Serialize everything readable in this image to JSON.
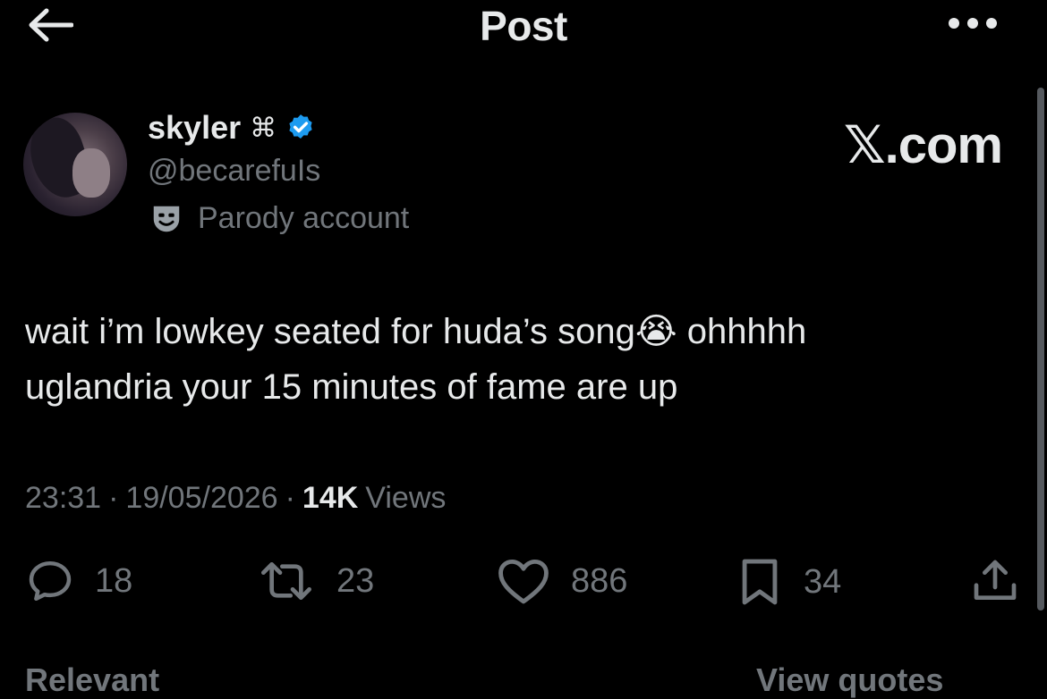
{
  "header": {
    "title": "Post",
    "back_icon": "arrow-left-icon",
    "more_icon": "more-horizontal-icon"
  },
  "author": {
    "name": "skyler",
    "name_symbol": "⌘",
    "handle": "@becarefuIs",
    "badge": "Parody account",
    "verified_color": "#1d9bf0"
  },
  "watermark": "𝕏.com",
  "tweet": {
    "line1_pre": "wait i’m lowkey seated for huda’s song",
    "emoji": "😭",
    "line1_post": " ohhhhh",
    "line2": "uglandria your 15 minutes of fame are up"
  },
  "meta": {
    "time": "23:31",
    "dot1": "·",
    "date": "19/05/2026",
    "dot2": "·",
    "views_count": "14K",
    "views_label": "Views"
  },
  "actions": {
    "replies": "18",
    "reposts": "23",
    "likes": "886",
    "bookmarks": "34"
  },
  "bottom": {
    "left": "Relevant",
    "right": "View quotes"
  },
  "colors": {
    "background": "#000000",
    "text": "#e7e9ea",
    "muted": "#71767b",
    "accent": "#1d9bf0"
  }
}
